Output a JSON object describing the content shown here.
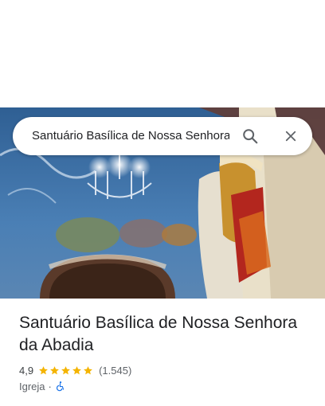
{
  "search": {
    "query": "Santuário Basílica de Nossa Senhora da Abadia"
  },
  "place": {
    "name": "Santuário Basílica de Nossa Senhora da Abadia",
    "rating": "4,9",
    "stars": 5,
    "reviews": "(1.545)",
    "category": "Igreja",
    "separator": "·"
  },
  "icons": {
    "search": "search-icon",
    "close": "close-icon",
    "star": "star-icon",
    "accessibility": "wheelchair-icon"
  },
  "colors": {
    "star": "#f4b400",
    "accessible": "#1a73e8"
  }
}
